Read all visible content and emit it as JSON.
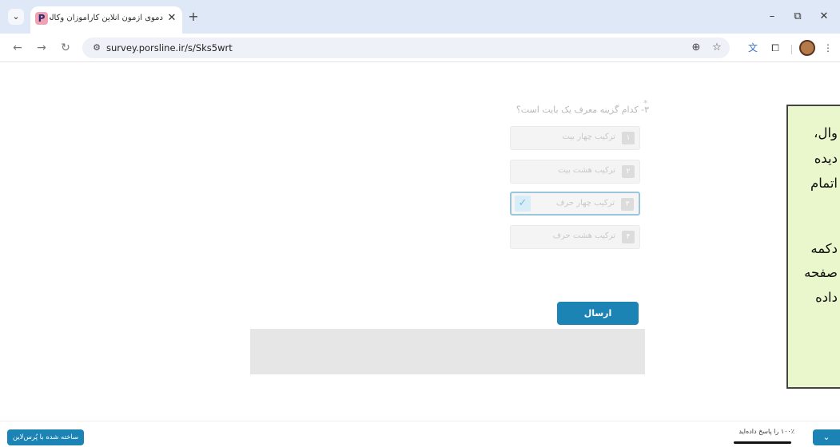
{
  "browser": {
    "tab_list_icon": "chevron-down-icon",
    "tab": {
      "title": "دموی آزمون آنلاین کارآموزان وکالت",
      "favicon_letter": "P",
      "close_glyph": "✕"
    },
    "new_tab_glyph": "+",
    "window_controls": {
      "minimize": "–",
      "restore": "⧉",
      "close": "✕"
    },
    "nav": {
      "back": "←",
      "forward": "→",
      "reload": "↻"
    },
    "site_info_glyph": "⚙",
    "url": "survey.porsline.ir/s/Sks5wrt",
    "zoom_glyph": "⊕",
    "bookmark_glyph": "☆",
    "translate_glyph": "文",
    "extensions_glyph": "⧠",
    "menu_glyph": "⋮"
  },
  "survey": {
    "required_mark": "*",
    "question": "۳- کدام گزینه معرف یک بایت است؟",
    "options": [
      {
        "number": "۱",
        "label": "ترکیب چهار بیت",
        "selected": false
      },
      {
        "number": "۲",
        "label": "ترکیب هشت بیت",
        "selected": false
      },
      {
        "number": "۳",
        "label": "ترکیب چهار حرف",
        "selected": true
      },
      {
        "number": "۴",
        "label": "ترکیب هشت حرف",
        "selected": false
      }
    ],
    "check_glyph": "✓",
    "submit_label": "ارسال"
  },
  "note": {
    "lines": [
      "وال،",
      "دیده",
      "اتمام",
      "دکمه",
      "صفحه",
      "داده"
    ],
    "background": "#eaf6cc"
  },
  "footer": {
    "brand_label": "ساخته شده با پُرس‌لاین",
    "progress_text": "۱۰۰٪ را پاسخ داده‌اید",
    "progress_fraction": 1.0,
    "chevron_glyph": "⌄",
    "accent": "#1b84b5"
  }
}
